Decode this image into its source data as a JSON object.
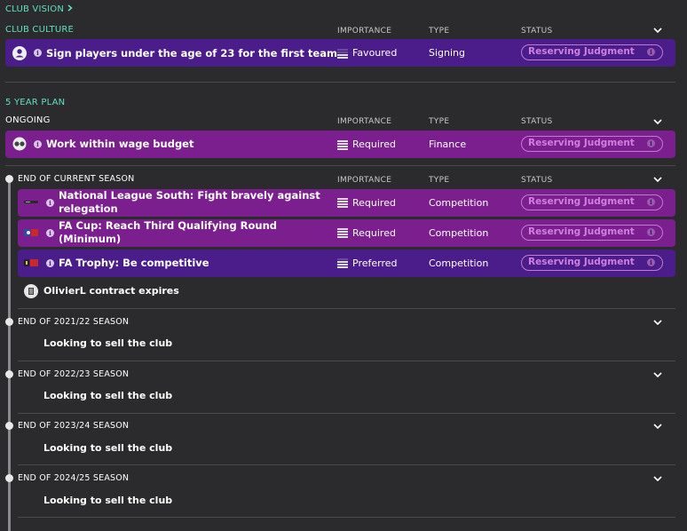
{
  "club_vision": {
    "label": "CLUB VISION",
    "chevron": "chevron-right-icon"
  },
  "club_culture": {
    "label": "CLUB CULTURE",
    "headers": {
      "importance": "IMPORTANCE",
      "type": "TYPE",
      "status": "STATUS"
    },
    "items": [
      {
        "title": "Sign players under the age of 23 for the first team",
        "icon": "person-icon",
        "importance": "Favoured",
        "type": "Signing",
        "status": "Reserving Judgment"
      }
    ]
  },
  "five_year_plan": {
    "label": "5 YEAR PLAN",
    "ongoing": {
      "label": "ONGOING",
      "headers": {
        "importance": "IMPORTANCE",
        "type": "TYPE",
        "status": "STATUS"
      },
      "items": [
        {
          "title": "Work within wage budget",
          "icon": "wage-icon",
          "importance": "Required",
          "type": "Finance",
          "status": "Reserving Judgment"
        }
      ]
    },
    "current_season": {
      "label": "END OF CURRENT SEASON",
      "headers": {
        "importance": "IMPORTANCE",
        "type": "TYPE",
        "status": "STATUS"
      },
      "items": [
        {
          "title": "National League South: Fight bravely against relegation",
          "icon": "league-logo-icon",
          "importance": "Required",
          "type": "Competition",
          "status": "Reserving Judgment"
        },
        {
          "title": "FA Cup: Reach Third Qualifying Round (Minimum)",
          "icon": "fa-cup-logo-icon",
          "importance": "Required",
          "type": "Competition",
          "status": "Reserving Judgment"
        },
        {
          "title": "FA Trophy: Be competitive",
          "icon": "fa-trophy-logo-icon",
          "importance": "Preferred",
          "type": "Competition",
          "status": "Reserving Judgment"
        }
      ],
      "note": "OlivierL contract expires"
    },
    "future_seasons": [
      {
        "label": "END OF 2021/22 SEASON",
        "text": "Looking to sell the club"
      },
      {
        "label": "END OF 2022/23 SEASON",
        "text": "Looking to sell the club"
      },
      {
        "label": "END OF 2023/24 SEASON",
        "text": "Looking to sell the club"
      },
      {
        "label": "END OF 2024/25 SEASON",
        "text": "Looking to sell the club"
      }
    ]
  },
  "colors": {
    "accent_teal": "#5fe0c0",
    "row_purple": "#4a1d8a",
    "row_magenta": "#7b1f8e",
    "status_pink": "#d07fe0"
  }
}
